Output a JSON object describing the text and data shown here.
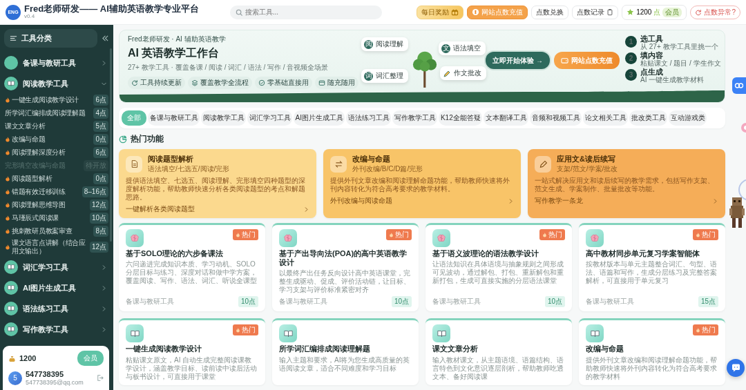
{
  "header": {
    "logo": "ENG",
    "title": "Fred老师研发—— AI辅助英语教学专业平台",
    "version": "v0.4",
    "search": {
      "placeholder": "搜索工具..."
    },
    "actions": [
      {
        "kind": "reward",
        "label": "每日奖励"
      },
      {
        "kind": "recharge",
        "label": "网站点数充值"
      },
      {
        "kind": "plain",
        "label": "点数兑换"
      },
      {
        "kind": "record",
        "label": "点数记录"
      }
    ],
    "points": {
      "value": "1200",
      "unit": "点",
      "badge": "会员"
    },
    "alert": "点数异常?"
  },
  "sidebar": {
    "title": "工具分类",
    "groups": [
      {
        "label": "备课与教研工具",
        "expanded": false
      },
      {
        "label": "阅读教学工具",
        "expanded": true,
        "children": [
          {
            "label": "一键生成阅读教学设计",
            "hot": true,
            "disabled": false,
            "cost": "6点"
          },
          {
            "label": "所学词汇编排成阅读理解题",
            "hot": false,
            "disabled": false,
            "cost": "4点"
          },
          {
            "label": "课文文章分析",
            "hot": false,
            "disabled": false,
            "cost": "5点"
          },
          {
            "label": "改编与命题",
            "hot": true,
            "disabled": false,
            "cost": "0点"
          },
          {
            "label": "阅读理解深度分析",
            "hot": true,
            "disabled": false,
            "cost": "6点"
          },
          {
            "label": "完形填空改编与命题",
            "hot": false,
            "disabled": true,
            "cost": "待开放"
          },
          {
            "label": "阅读题型解析",
            "hot": true,
            "disabled": false,
            "cost": "0点"
          },
          {
            "label": "错题有效迁移训练",
            "hot": true,
            "disabled": false,
            "cost": "8–16点"
          },
          {
            "label": "阅读理解思维导图",
            "hot": true,
            "disabled": false,
            "cost": "12点"
          },
          {
            "label": "马瑾辰式阅读课",
            "hot": true,
            "disabled": false,
            "cost": "10点"
          },
          {
            "label": "挑刺教研员教案审查",
            "hot": true,
            "disabled": false,
            "cost": "8点"
          },
          {
            "label": "课文语言点讲解（结合应用文输出）",
            "hot": true,
            "disabled": false,
            "cost": "12点"
          }
        ]
      },
      {
        "label": "词汇学习工具",
        "expanded": false
      },
      {
        "label": "AI图片生成工具",
        "expanded": false
      },
      {
        "label": "语法练习工具",
        "expanded": false
      },
      {
        "label": "写作教学工具",
        "expanded": false
      }
    ],
    "account": {
      "balance": "1200",
      "member_button": "会员",
      "avatar": "5",
      "name": "547738395",
      "email": "547738395@qq.com"
    }
  },
  "hero": {
    "tagline": "Fred老师研发 · AI 辅助英语教学",
    "title": "AI 英语教学工作台",
    "subtitle": "27+ 教学工具 · 覆盖备课 / 阅读 / 词汇 / 语法 / 写作 / 音视频全场景",
    "features": [
      "工具持续更新",
      "覆盖教学全流程",
      "零基础直接用",
      "随充随用"
    ],
    "floating_tags": [
      {
        "glyph": "阅",
        "label": "阅读理解"
      },
      {
        "glyph": "文",
        "label": "语法填空"
      },
      {
        "glyph": "词",
        "label": "词汇整理"
      },
      {
        "label": "作文批改"
      }
    ],
    "buttons": [
      {
        "kind": "primary",
        "label": "立即开始体验 →"
      },
      {
        "kind": "recharge",
        "label": "网站点数充值"
      }
    ],
    "steps": [
      {
        "number": "1",
        "title": "选工具",
        "detail": "从 27+ 教学工具里挑一个"
      },
      {
        "number": "2",
        "title": "填内容",
        "detail": "粘贴课文 / 题目 / 学生作文"
      },
      {
        "number": "3",
        "title": "点生成",
        "detail": "AI 一键生成教学材料"
      }
    ]
  },
  "tabs": [
    {
      "label": "全部",
      "selected": true
    },
    {
      "label": "备课与教研工具",
      "selected": false
    },
    {
      "label": "阅读教学工具",
      "selected": false
    },
    {
      "label": "词汇学习工具",
      "selected": false
    },
    {
      "label": "AI图片生成工具",
      "selected": false
    },
    {
      "label": "语法练习工具",
      "selected": false
    },
    {
      "label": "写作教学工具",
      "selected": false
    },
    {
      "label": "K12全能答疑",
      "selected": false
    },
    {
      "label": "文本翻译工具",
      "selected": false
    },
    {
      "label": "音频和视频工具",
      "selected": false
    },
    {
      "label": "论文相关工具",
      "selected": false
    },
    {
      "label": "批改类工具",
      "selected": false
    },
    {
      "label": "互动游戏类",
      "selected": false
    }
  ],
  "hot_features": {
    "title": "热门功能",
    "items": [
      {
        "title": "阅读题型解析",
        "tags": "语法填空/七选五/阅读/完形",
        "description": "提供语法填空、七选五、阅读理解、完形填空四种题型的深度解析功能，帮助教师快速分析各类阅读题型的考点和解题思路。",
        "link": "一键解析各类阅读题型",
        "color": "#fbd98e"
      },
      {
        "title": "改编与命题",
        "tags": "外刊改编/B/C/D篇/完形",
        "description": "提供外刊文章改编和阅读理解命题功能，帮助教师快速将外刊内容转化为符合高考要求的教学材料。",
        "link": "外刊改编与阅读命题",
        "color": "#f8c468"
      },
      {
        "title": "应用文&读后续写",
        "tags": "支架/范文/学案/批改",
        "description": "一站式解决应用文和读后续写的教学需求，包括写作支架、范文生成、学案制作、批量批改等功能。",
        "link": "写作教学一条龙",
        "color": "#f5ad58"
      }
    ]
  },
  "tool_cards": [
    {
      "kind": "brain",
      "badge": "热门",
      "title": "基于SOLO理论的六步备课法",
      "description": "六问递进完成知识本质、学习动机、SOLO分层目标与练习、深度对话和做中学方案，覆盖阅读、写作、语法、词汇、听说全课型",
      "category": "备课与教研工具",
      "cost": "10点"
    },
    {
      "kind": "brain",
      "badge": "热门",
      "title": "基于产出导向法(POA)的高中英语教学设计",
      "description": "以最终产出任务反向设计高中英语课堂，完整生成驱动、促成、评价活动链，让目标、学习支架与评价标准紧密对齐",
      "category": "备课与教研工具",
      "cost": "10点"
    },
    {
      "kind": "brain",
      "badge": "热门",
      "title": "基于语义波理论的语法教学设计",
      "description": "让语法知识在具体语境与抽象规则之间形成可见波动，通过解包、打包、重新解包和重新打包，生成可直接实施的分层语法课堂",
      "category": "备课与教研工具",
      "cost": "10点"
    },
    {
      "kind": "brain",
      "badge": "热门",
      "title": "高中教材同步单元复习学案智能体",
      "description": "按教材版本与单元主题整合词汇、句型、语法、语篇和写作，生成分层练习及完整答案解析，可直接用于单元复习",
      "category": "备课与教研工具",
      "cost": "15点"
    },
    {
      "kind": "book",
      "badge": "热门",
      "title": "一键生成阅读教学设计",
      "description": "粘贴课文原文，AI 自动生成完整阅读课教学设计，涵盖教学目标、读前读中读后活动与板书设计，可直接用于课堂"
    },
    {
      "kind": "book",
      "title": "所学词汇编排成阅读理解题",
      "description": "输入主题和要求，AI将为您生成高质量的英语阅读文章，适合不同难度和学习目标"
    },
    {
      "kind": "book",
      "title": "课文文章分析",
      "description": "输入教材课文，从主题语境、语篇结构、语言特色到文化意识逐层剖析，帮助教师吃透文本、备好阅读课"
    },
    {
      "kind": "book",
      "badge": "热门",
      "title": "改编与命题",
      "description": "提供外刊文章改编和阅读理解命题功能，帮助教师快速将外刊内容转化为符合高考要求的教学材料"
    }
  ]
}
